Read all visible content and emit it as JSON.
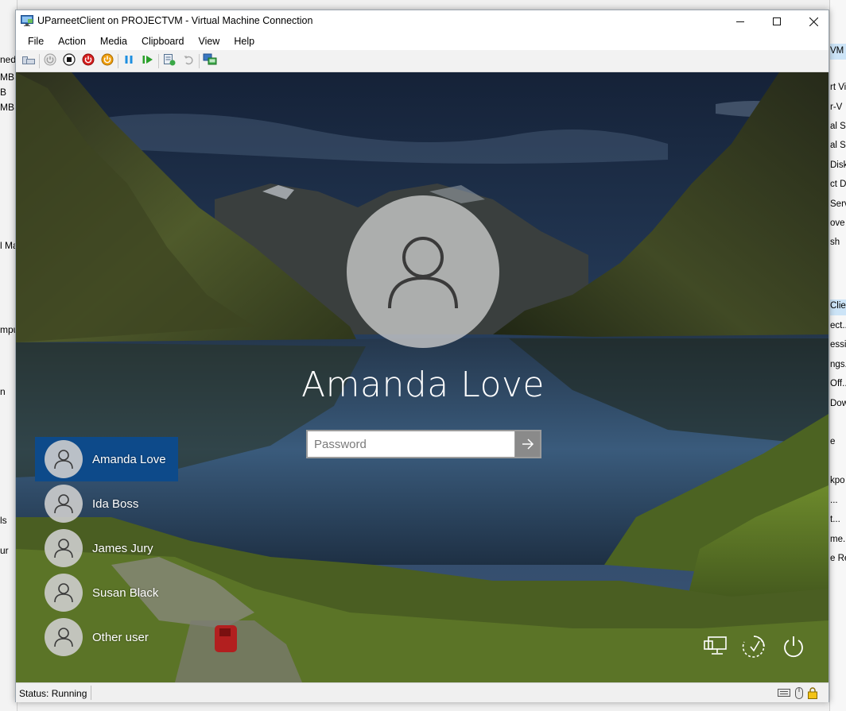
{
  "background_window": {
    "left_fragments": [
      "ned",
      "MB",
      "B",
      "MB",
      "l Ma",
      "mpu",
      "n",
      "ls",
      "ur"
    ],
    "right_fragments": {
      "header": "VM",
      "items": [
        "rt Vi",
        "r-V",
        "al Sv",
        "al SA",
        "Disk...",
        "ct D",
        "Serv",
        "ove S",
        "sh"
      ],
      "selected": "Clier",
      "items2": [
        "ect...",
        "essi",
        "ngs...",
        "Off...",
        "Dow"
      ],
      "items3": [
        "e",
        "kpo",
        "...",
        "t...",
        "me...",
        "e Re"
      ]
    }
  },
  "window": {
    "title": "UParneetClient on PROJECTVM - Virtual Machine Connection",
    "controls": {
      "minimize": "—",
      "maximize": "☐",
      "close": "✕"
    }
  },
  "menu": [
    "File",
    "Action",
    "Media",
    "Clipboard",
    "View",
    "Help"
  ],
  "toolbar": [
    {
      "name": "ctrl-alt-del-icon"
    },
    {
      "name": "start-icon"
    },
    {
      "name": "turn-off-icon"
    },
    {
      "name": "shut-down-icon"
    },
    {
      "name": "save-icon"
    },
    {
      "name": "pause-icon"
    },
    {
      "name": "resume-icon"
    },
    {
      "name": "checkpoint-icon"
    },
    {
      "name": "revert-icon"
    },
    {
      "name": "enhanced-session-icon"
    }
  ],
  "lock_screen": {
    "user_name": "Amanda Love",
    "password_placeholder": "Password",
    "users": [
      {
        "name": "Amanda Love",
        "active": true
      },
      {
        "name": "Ida Boss",
        "active": false
      },
      {
        "name": "James Jury",
        "active": false
      },
      {
        "name": "Susan Black",
        "active": false
      },
      {
        "name": "Other user",
        "active": false
      }
    ],
    "system_icons": [
      "network-icon",
      "ease-of-access-icon",
      "power-icon"
    ],
    "selected_color": "#0d4a8a"
  },
  "status": {
    "text": "Status: Running",
    "indicators": [
      "keyboard-icon",
      "mouse-icon",
      "lock-icon"
    ]
  }
}
